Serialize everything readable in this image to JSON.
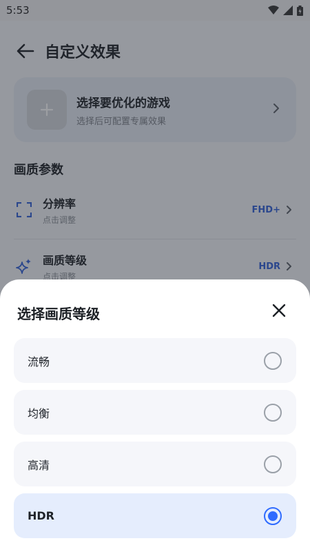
{
  "status": {
    "time": "5:53"
  },
  "appbar": {
    "title": "自定义效果"
  },
  "game_card": {
    "title": "选择要优化的游戏",
    "subtitle": "选择后可配置专属效果"
  },
  "section": {
    "title": "画质参数"
  },
  "settings": [
    {
      "title": "分辨率",
      "subtitle": "点击调整",
      "value": "FHD+"
    },
    {
      "title": "画质等级",
      "subtitle": "点击调整",
      "value": "HDR"
    }
  ],
  "sheet": {
    "title": "选择画质等级",
    "options": [
      {
        "label": "流畅",
        "selected": false
      },
      {
        "label": "均衡",
        "selected": false
      },
      {
        "label": "高清",
        "selected": false
      },
      {
        "label": "HDR",
        "selected": true
      }
    ]
  },
  "colors": {
    "accent": "#2f6bff",
    "value_text": "#2f5ed8"
  }
}
